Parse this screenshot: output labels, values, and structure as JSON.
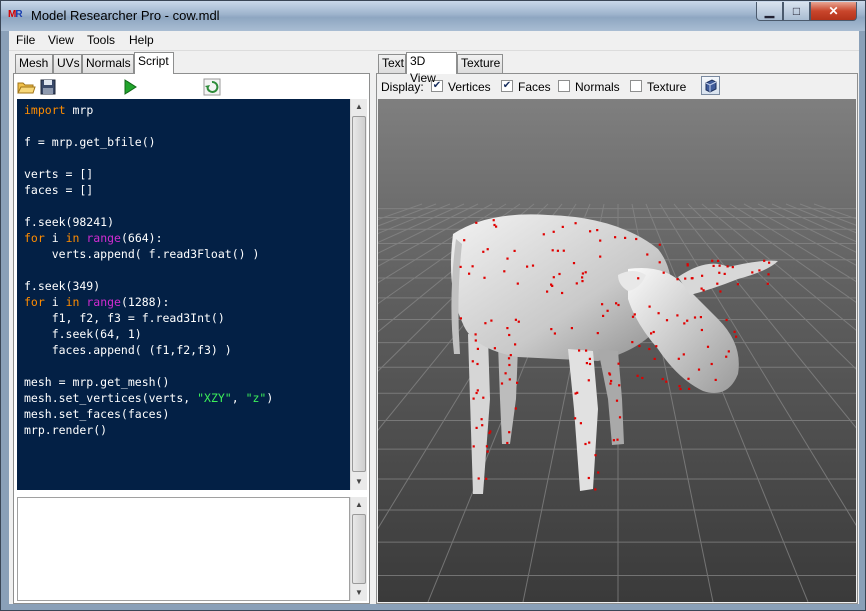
{
  "window": {
    "title": "Model Researcher Pro - cow.mdl",
    "app_icon_text_a": "M",
    "app_icon_text_b": "R",
    "min_symbol": "▁",
    "max_symbol": "□",
    "close_symbol": "✕"
  },
  "menu": [
    "File",
    "View",
    "Tools",
    "Help"
  ],
  "left_tabs": [
    {
      "label": "Mesh",
      "active": false
    },
    {
      "label": "UVs",
      "active": false
    },
    {
      "label": "Normals",
      "active": false
    },
    {
      "label": "Script",
      "active": true
    }
  ],
  "right_tabs": [
    {
      "label": "Text",
      "active": false
    },
    {
      "label": "3D View",
      "active": true
    },
    {
      "label": "Texture",
      "active": false
    }
  ],
  "toolbar": {
    "icons": [
      "open-folder-icon",
      "save-icon",
      "run-icon",
      "clear-icon"
    ]
  },
  "script": {
    "lines": [
      [
        [
          "kw",
          "import"
        ],
        [
          "plain",
          " mrp"
        ]
      ],
      [],
      [
        [
          "plain",
          "f = mrp.get_bfile()"
        ]
      ],
      [],
      [
        [
          "plain",
          "verts = []"
        ]
      ],
      [
        [
          "plain",
          "faces = []"
        ]
      ],
      [],
      [
        [
          "plain",
          "f.seek(98241)"
        ]
      ],
      [
        [
          "kw",
          "for"
        ],
        [
          "plain",
          " i "
        ],
        [
          "kw",
          "in"
        ],
        [
          "plain",
          " "
        ],
        [
          "fn",
          "range"
        ],
        [
          "plain",
          "(664):"
        ]
      ],
      [
        [
          "plain",
          "    verts.append( f.read3Float() )"
        ]
      ],
      [],
      [
        [
          "plain",
          "f.seek(349)"
        ]
      ],
      [
        [
          "kw",
          "for"
        ],
        [
          "plain",
          " i "
        ],
        [
          "kw",
          "in"
        ],
        [
          "plain",
          " "
        ],
        [
          "fn",
          "range"
        ],
        [
          "plain",
          "(1288):"
        ]
      ],
      [
        [
          "plain",
          "    f1, f2, f3 = f.read3Int()"
        ]
      ],
      [
        [
          "plain",
          "    f.seek(64, 1)"
        ]
      ],
      [
        [
          "plain",
          "    faces.append( (f1,f2,f3) )"
        ]
      ],
      [],
      [
        [
          "plain",
          "mesh = mrp.get_mesh()"
        ]
      ],
      [
        [
          "plain",
          "mesh.set_vertices(verts, "
        ],
        [
          "str",
          "\"XZY\""
        ],
        [
          "plain",
          ", "
        ],
        [
          "str",
          "\"z\""
        ],
        [
          "plain",
          ")"
        ]
      ],
      [
        [
          "plain",
          "mesh.set_faces(faces)"
        ]
      ],
      [
        [
          "plain",
          "mrp.render()"
        ]
      ]
    ]
  },
  "output": {
    "text": ""
  },
  "display": {
    "label": "Display:",
    "options": [
      {
        "label": "Vertices",
        "checked": true
      },
      {
        "label": "Faces",
        "checked": true
      },
      {
        "label": "Normals",
        "checked": false
      },
      {
        "label": "Texture",
        "checked": false
      }
    ]
  },
  "colors": {
    "editor_bg": "#032045",
    "keyword": "#ff8c00",
    "builtin": "#d02cd0",
    "string": "#3cf05a",
    "vertex_marker": "#e00000"
  }
}
